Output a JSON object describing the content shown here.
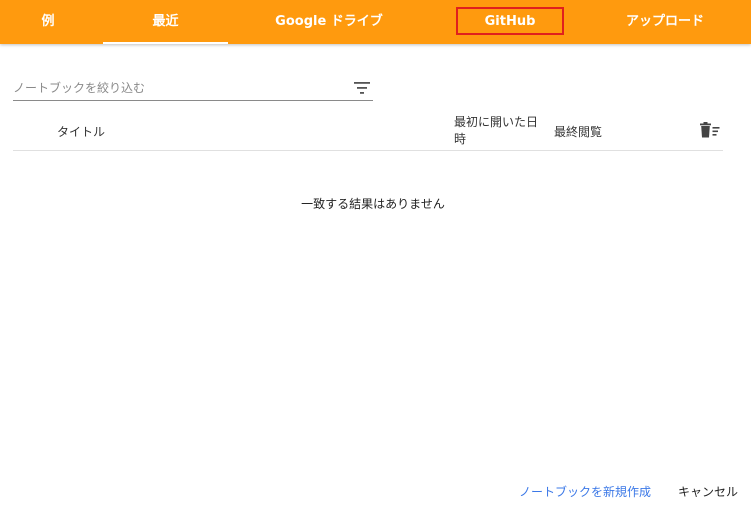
{
  "tabs": [
    {
      "label": "例",
      "active": false
    },
    {
      "label": "最近",
      "active": true
    },
    {
      "label": "Google ドライブ",
      "active": false
    },
    {
      "label": "GitHub",
      "active": false,
      "highlighted": true
    },
    {
      "label": "アップロード",
      "active": false
    }
  ],
  "colors": {
    "tab_bar": "#ff9a0e",
    "tab_text": "#ffffff",
    "highlight_border": "#e0201e",
    "link": "#3b78e7"
  },
  "search": {
    "placeholder": "ノートブックを絞り込む",
    "value": "",
    "filter_icon": "filter-icon"
  },
  "table": {
    "columns": {
      "title": "タイトル",
      "first_opened": "最初に開いた日時",
      "last_viewed": "最終閲覧"
    },
    "trash_icon": "trash-icon",
    "rows": []
  },
  "empty_message": "一致する結果はありません",
  "footer": {
    "new_notebook": "ノートブックを新規作成",
    "cancel": "キャンセル"
  }
}
